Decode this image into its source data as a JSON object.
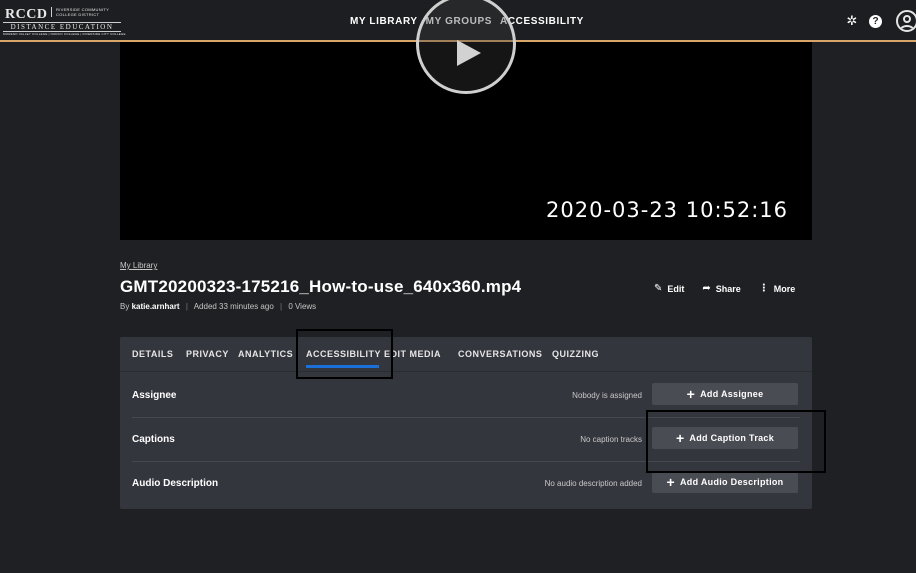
{
  "header": {
    "logo": {
      "rccd": "RCCD",
      "district": "RIVERSIDE COMMUNITY COLLEGE DISTRICT",
      "distance": "DISTANCE EDUCATION",
      "colleges": "MORENO VALLEY COLLEGE | NORCO COLLEGE | RIVERSIDE CITY COLLEGE"
    },
    "nav": [
      "MY LIBRARY",
      "MY GROUPS",
      "ACCESSIBILITY"
    ],
    "icons": {
      "settings": "gear-icon",
      "help": "help-icon",
      "avatar": "user-avatar"
    },
    "accent_color": "#d9a66a"
  },
  "video": {
    "overlay_timestamp": "2020-03-23 10:52:16"
  },
  "media": {
    "breadcrumb": "My Library",
    "title": "GMT20200323-175216_How-to-use_640x360.mp4",
    "by_label": "By",
    "owner": "katie.arnhart",
    "added": "Added 33 minutes ago",
    "views": "0 Views",
    "actions": {
      "edit": "Edit",
      "share": "Share",
      "more": "More"
    }
  },
  "tabs": {
    "items": [
      "DETAILS",
      "PRIVACY",
      "ANALYTICS",
      "ACCESSIBILITY",
      "EDIT MEDIA",
      "CONVERSATIONS",
      "QUIZZING"
    ],
    "active": "ACCESSIBILITY",
    "active_color": "#1b6fd8"
  },
  "accessibility": {
    "rows": [
      {
        "label": "Assignee",
        "status": "Nobody is assigned",
        "button": "Add Assignee"
      },
      {
        "label": "Captions",
        "status": "No caption tracks",
        "button": "Add Caption Track"
      },
      {
        "label": "Audio Description",
        "status": "No audio description added",
        "button": "Add Audio Description"
      }
    ]
  }
}
